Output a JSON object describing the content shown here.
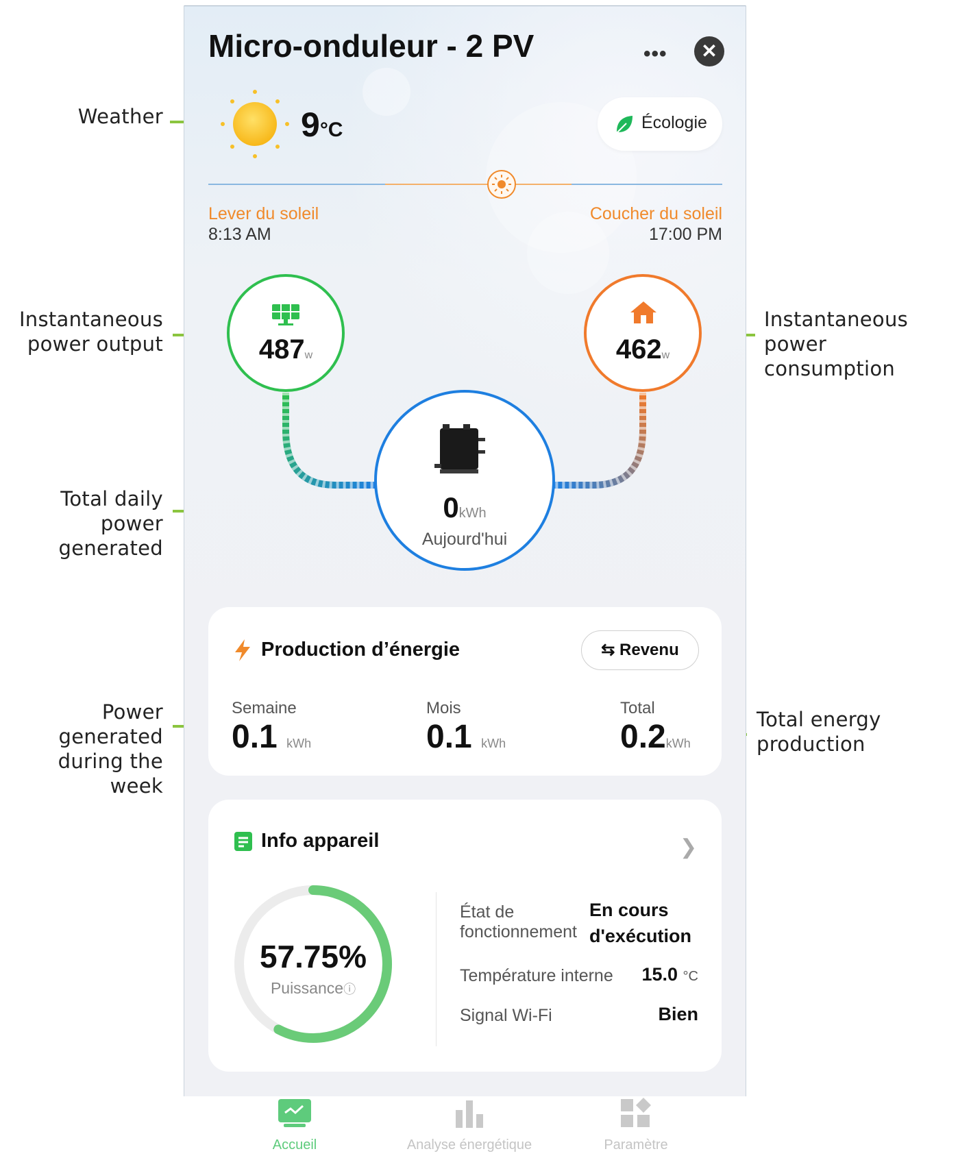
{
  "annotations": {
    "weather": "Weather",
    "power_output": [
      "Instantaneous",
      "power output"
    ],
    "power_consumption": [
      "Instantaneous",
      "power consumption"
    ],
    "daily_generated": [
      "Total daily power",
      "generated"
    ],
    "week_generated": [
      "Power generated",
      "during the week"
    ],
    "total_production": [
      "Total energy",
      "production"
    ]
  },
  "header": {
    "title": "Micro-onduleur - 2 PV",
    "menu": "•••",
    "close": "✕"
  },
  "weather": {
    "temperature": "9",
    "unit": "°C",
    "mode_label": "Écologie",
    "sunrise_label": "Lever du soleil",
    "sunrise_time": "8:13 AM",
    "sunset_label": "Coucher du soleil",
    "sunset_time": "17:00 PM"
  },
  "flow": {
    "pv_value": "487",
    "pv_unit": "w",
    "home_value": "462",
    "home_unit": "w",
    "today_value": "0",
    "today_unit": "kWh",
    "today_label": "Aujourd'hui"
  },
  "production": {
    "title": "Production d’énergie",
    "toggle_label": "Revenu",
    "stats": [
      {
        "label": "Semaine",
        "value": "0.1",
        "unit": "kWh"
      },
      {
        "label": "Mois",
        "value": "0.1",
        "unit": "kWh"
      },
      {
        "label": "Total",
        "value": "0.2",
        "unit": "kWh"
      }
    ]
  },
  "device_info": {
    "title": "Info appareil",
    "power_percent": "57.75%",
    "power_fraction": 0.5775,
    "power_label": "Puissance",
    "rows": [
      {
        "key_line1": "État de",
        "key_line2": "fonctionnement",
        "value_line1": "En cours",
        "value_line2": "d'exécution"
      },
      {
        "key": "Température interne",
        "value": "15.0",
        "unit": "°C"
      },
      {
        "key": "Signal Wi-Fi",
        "value": "Bien"
      }
    ]
  },
  "tabs": [
    {
      "label": "Accueil",
      "active": true
    },
    {
      "label": "Analyse énergétique",
      "active": false
    },
    {
      "label": "Paramètre",
      "active": false
    }
  ],
  "colors": {
    "accent_green": "#2fbf4f",
    "accent_orange": "#f07a2c",
    "accent_blue": "#1e7fe0",
    "annotation_arrow": "#8bc53f"
  }
}
